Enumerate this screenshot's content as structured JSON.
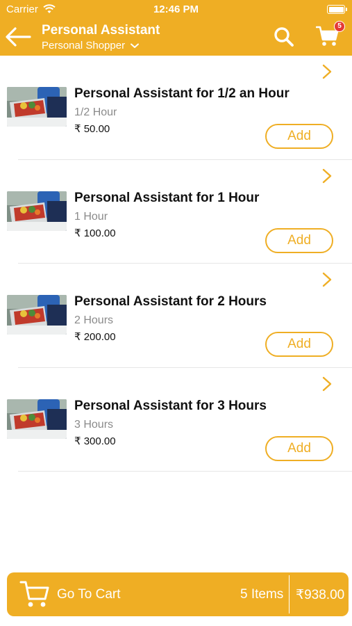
{
  "status_bar": {
    "carrier": "Carrier",
    "time": "12:46 PM"
  },
  "header": {
    "title": "Personal Assistant",
    "subtitle": "Personal Shopper",
    "cart_count": "5"
  },
  "colors": {
    "accent": "#EFAE24",
    "badge": "#E53935",
    "muted_text": "#8a8a8a"
  },
  "icons": [
    "back-arrow-icon",
    "search-icon",
    "cart-icon",
    "chevron-down-icon",
    "chevron-right-icon"
  ],
  "services": [
    {
      "name": "Personal Assistant for 1/2 an Hour",
      "duration": "1/2 Hour",
      "price": "₹ 50.00",
      "button": "Add"
    },
    {
      "name": "Personal Assistant for 1 Hour",
      "duration": "1 Hour",
      "price": "₹ 100.00",
      "button": "Add"
    },
    {
      "name": "Personal Assistant for 2 Hours",
      "duration": "2 Hours",
      "price": "₹ 200.00",
      "button": "Add"
    },
    {
      "name": "Personal Assistant for 3 Hours",
      "duration": "3 Hours",
      "price": "₹ 300.00",
      "button": "Add"
    }
  ],
  "footer": {
    "go_to_cart": "Go To Cart",
    "items": "5 Items",
    "total": "₹938.00"
  }
}
